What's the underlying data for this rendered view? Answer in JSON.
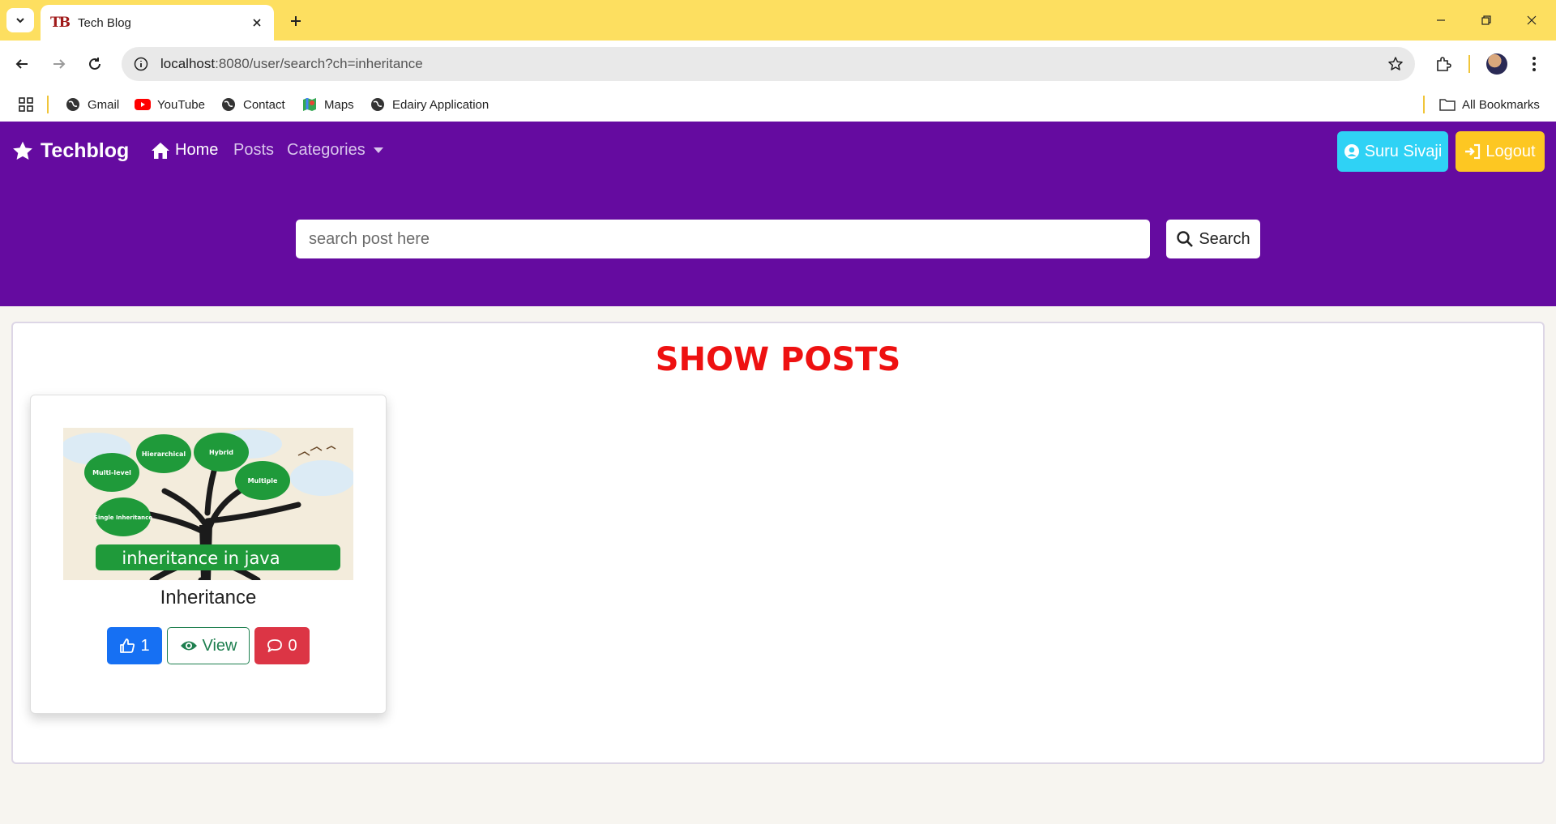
{
  "browser": {
    "tab_title": "Tech Blog",
    "favicon_text": "TB",
    "url_host": "localhost",
    "url_path": ":8080/user/search?ch=inheritance",
    "bookmarks": [
      {
        "label": "Gmail",
        "icon": "globe-icon"
      },
      {
        "label": "YouTube",
        "icon": "youtube-icon"
      },
      {
        "label": "Contact",
        "icon": "globe-icon"
      },
      {
        "label": "Maps",
        "icon": "maps-icon"
      },
      {
        "label": "Edairy Application",
        "icon": "globe-icon"
      }
    ],
    "all_bookmarks": "All Bookmarks",
    "tabstrip_color": "#fddf60"
  },
  "navbar": {
    "brand": "Techblog",
    "links": {
      "home": "Home",
      "posts": "Posts",
      "categories": "Categories"
    },
    "user_button": "Suru Sivaji",
    "logout_button": "Logout",
    "color": "#650ba0"
  },
  "search": {
    "placeholder": "search post here",
    "button": "Search"
  },
  "main": {
    "heading": "SHOW POSTS",
    "posts": [
      {
        "title": "Inheritance",
        "image_text": {
          "banner": "inheritance in java",
          "bubbles": [
            "Multi-level",
            "Hierarchical",
            "Hybrid",
            "Multiple",
            "Single Inheritance"
          ]
        },
        "likes": "1",
        "view_label": "View",
        "comments": "0"
      }
    ]
  }
}
